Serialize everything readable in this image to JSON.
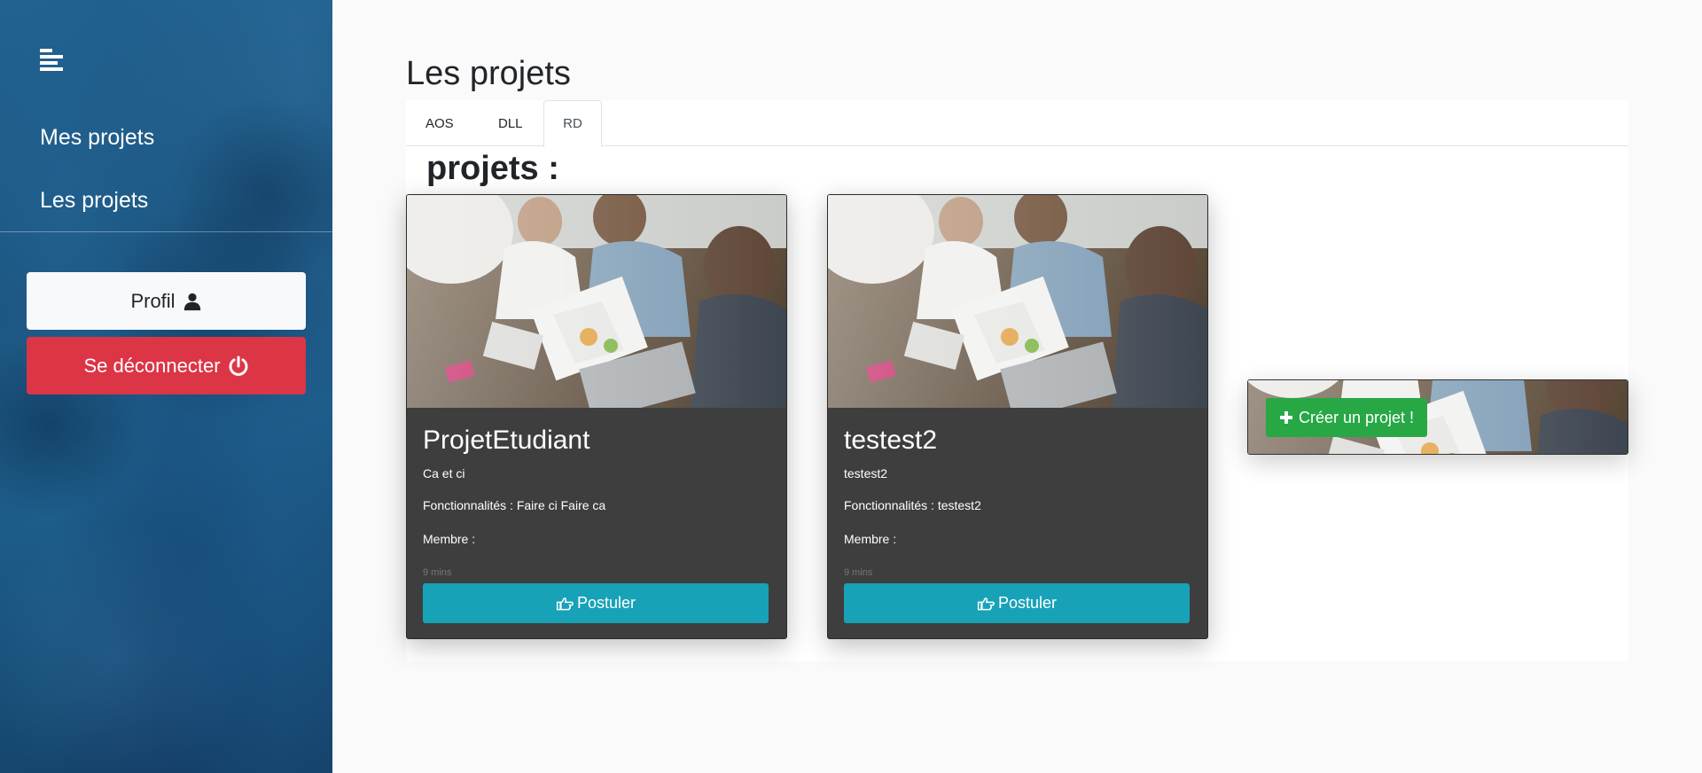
{
  "sidebar": {
    "nav": [
      {
        "label": "Mes projets"
      },
      {
        "label": "Les projets"
      }
    ],
    "profile_label": "Profil",
    "logout_label": "Se déconnecter"
  },
  "main": {
    "title": "Les projets",
    "tabs": [
      {
        "label": "AOS"
      },
      {
        "label": "DLL"
      },
      {
        "label": "RD",
        "active": true
      }
    ],
    "section_title": "projets :",
    "projects": [
      {
        "title": "ProjetEtudiant",
        "description": "Ca et ci",
        "features": "Fonctionnalités : Faire ci Faire ca",
        "members": "Membre :",
        "time": "9 mins",
        "apply_label": "Postuler"
      },
      {
        "title": "testest2",
        "description": "testest2",
        "features": "Fonctionnalités : testest2",
        "members": "Membre :",
        "time": "9 mins",
        "apply_label": "Postuler"
      }
    ],
    "create_label": "Créer un projet !"
  },
  "icons": {
    "menu": "menu-toggle-icon",
    "user": "user-icon",
    "power": "power-icon",
    "hand": "hand-point-right-icon",
    "plus": "plus-icon"
  },
  "colors": {
    "sidebar_bg": "#1b5a86",
    "danger": "#dc3545",
    "info": "#17a2b8",
    "success": "#28a745",
    "card_bg": "#3e3e3e"
  }
}
